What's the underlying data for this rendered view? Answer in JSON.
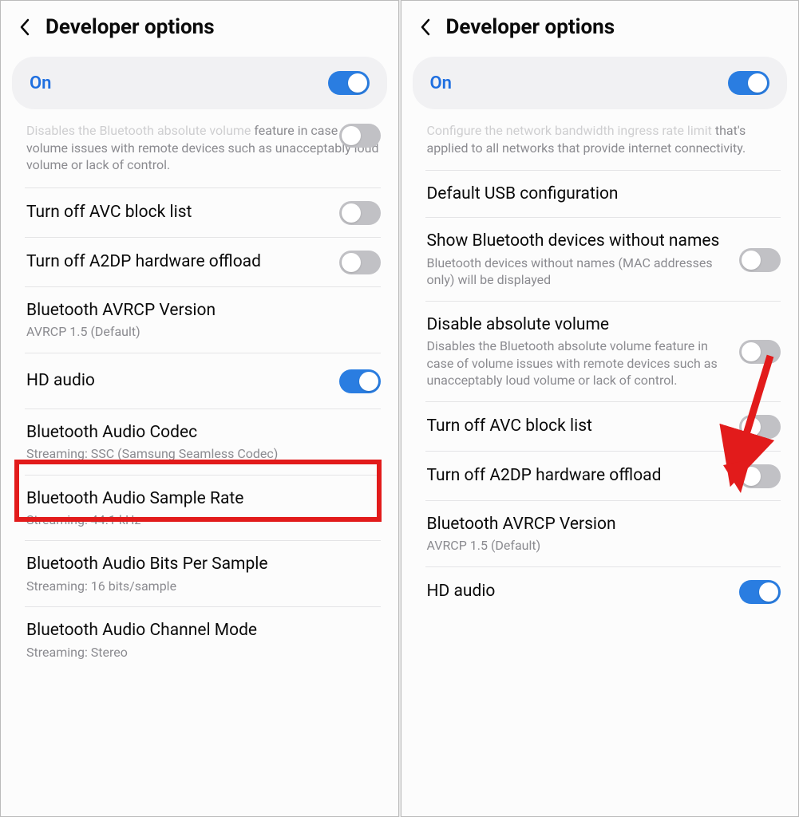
{
  "left": {
    "title": "Developer options",
    "master": {
      "label": "On",
      "state": "on"
    },
    "partial_desc": "Disables the Bluetooth absolute volume feature in case of volume issues with remote devices such as unacceptably loud volume or lack of control.",
    "items": [
      {
        "title": "Turn off AVC block list",
        "sub": "",
        "toggle": "off"
      },
      {
        "title": "Turn off A2DP hardware offload",
        "sub": "",
        "toggle": "off"
      },
      {
        "title": "Bluetooth AVRCP Version",
        "sub": "AVRCP 1.5 (Default)",
        "toggle": null
      },
      {
        "title": "HD audio",
        "sub": "",
        "toggle": "on",
        "highlight": true
      },
      {
        "title": "Bluetooth Audio Codec",
        "sub": "Streaming: SSC (Samsung Seamless Codec)",
        "toggle": null
      },
      {
        "title": "Bluetooth Audio Sample Rate",
        "sub": "Streaming: 44.1 kHz",
        "toggle": null
      },
      {
        "title": "Bluetooth Audio Bits Per Sample",
        "sub": "Streaming: 16 bits/sample",
        "toggle": null
      },
      {
        "title": "Bluetooth Audio Channel Mode",
        "sub": "Streaming: Stereo",
        "toggle": null
      }
    ]
  },
  "right": {
    "title": "Developer options",
    "master": {
      "label": "On",
      "state": "on"
    },
    "partial_desc": "Configure the network bandwidth ingress rate limit that's applied to all networks that provide internet connectivity.",
    "items": [
      {
        "title": "Default USB configuration",
        "sub": "",
        "toggle": null
      },
      {
        "title": "Show Bluetooth devices without names",
        "sub": "Bluetooth devices without names (MAC addresses only) will be displayed",
        "toggle": "off"
      },
      {
        "title": "Disable absolute volume",
        "sub": "Disables the Bluetooth absolute volume feature in case of volume issues with remote devices such as unacceptably loud volume or lack of control.",
        "toggle": "off",
        "arrow": true
      },
      {
        "title": "Turn off AVC block list",
        "sub": "",
        "toggle": "off"
      },
      {
        "title": "Turn off A2DP hardware offload",
        "sub": "",
        "toggle": "off"
      },
      {
        "title": "Bluetooth AVRCP Version",
        "sub": "AVRCP 1.5 (Default)",
        "toggle": null
      },
      {
        "title": "HD audio",
        "sub": "",
        "toggle": "on"
      }
    ]
  }
}
